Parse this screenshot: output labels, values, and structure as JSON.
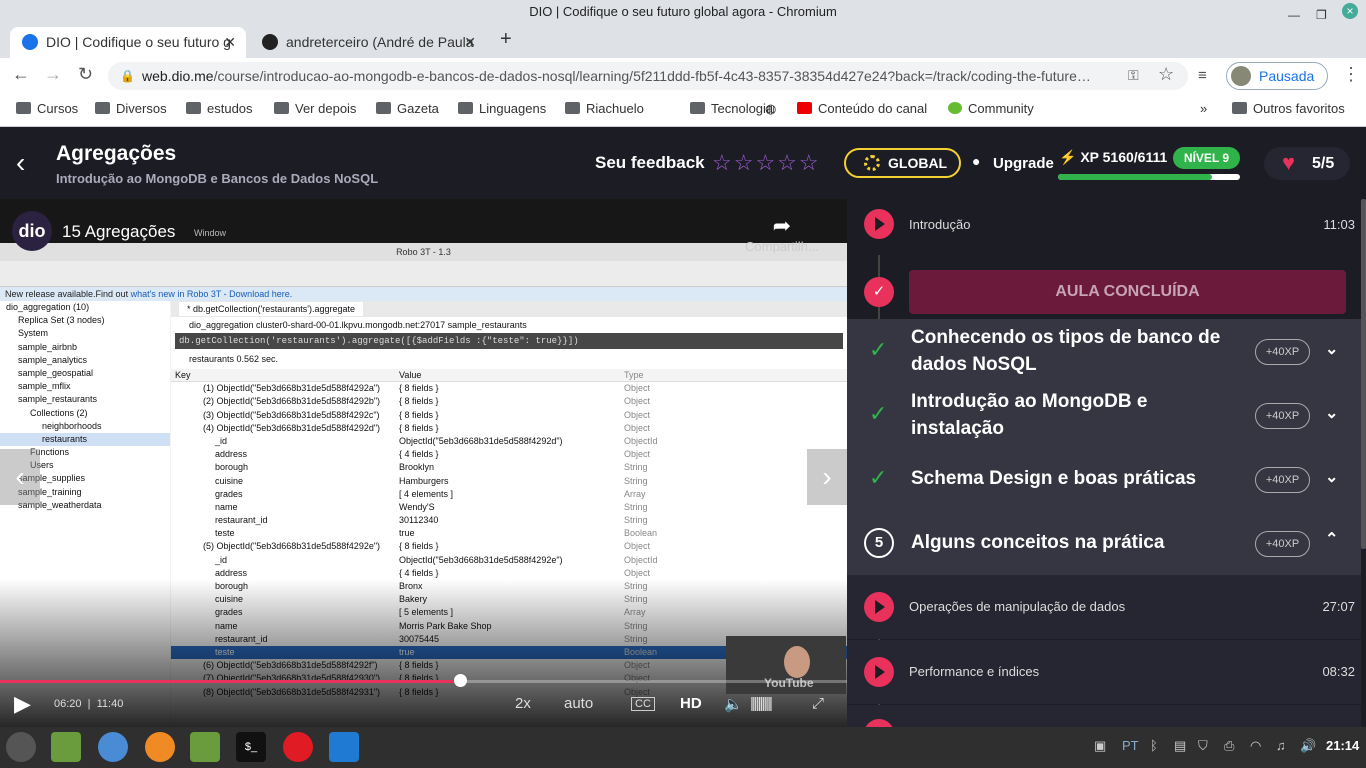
{
  "window": {
    "title": "DIO | Codifique o seu futuro global agora - Chromium"
  },
  "tabs": [
    {
      "label": "DIO | Codifique o seu futuro g"
    },
    {
      "label": "andreterceiro (André de Paula"
    }
  ],
  "address": {
    "domain": "web.dio.me",
    "path": "/course/introducao-ao-mongodb-e-bancos-de-dados-nosql/learning/5f211ddd-fb5f-4c43-8357-38354d427e24?back=/track/coding-the-future…",
    "profile": "Pausada"
  },
  "bookmarks": [
    "Cursos",
    "Diversos",
    "estudos",
    "Ver depois",
    "Gazeta",
    "Linguagens",
    "Riachuelo",
    "Tecnologia",
    "Conteúdo do canal",
    "Community",
    "Outros favoritos"
  ],
  "header": {
    "title": "Agregações",
    "subtitle": "Introdução ao MongoDB e Bancos de Dados NoSQL",
    "feedback": "Seu feedback",
    "global": "GLOBAL",
    "upgrade": "Upgrade",
    "xp": "XP 5160/6111",
    "xp_fraction": 0.845,
    "level": "NÍVEL 9",
    "lives": "5/5"
  },
  "video": {
    "title": "15 Agregações",
    "window_menu": "Window",
    "share": "Compartilh...",
    "current": "06:20",
    "duration": "11:40",
    "speed": "2x",
    "quality_mode": "auto",
    "hd": "HD",
    "progress_fraction": 0.543,
    "robo_title": "Robo 3T - 1.3",
    "notice": "New release available.Find out ",
    "notice_link": "what's new in Robo 3T - Download here.",
    "tab": "* db.getCollection('restaurants').aggregate",
    "conn": "dio_aggregation      cluster0-shard-00-01.lkpvu.mongodb.net:27017      sample_restaurants",
    "query": "db.getCollection('restaurants').aggregate([{$addFields :{\"teste\": true}}])",
    "result": "restaurants      0.562 sec.",
    "cols": [
      "Key",
      "Value",
      "Type"
    ],
    "tree": [
      "dio_aggregation (10)",
      "Replica Set (3 nodes)",
      "System",
      "sample_airbnb",
      "sample_analytics",
      "sample_geospatial",
      "sample_mflix",
      "sample_restaurants",
      "Collections (2)",
      "neighborhoods",
      "restaurants",
      "Functions",
      "Users",
      "sample_supplies",
      "sample_training",
      "sample_weatherdata"
    ],
    "rows": [
      [
        "(1) ObjectId(\"5eb3d668b31de5d588f4292a\")",
        "{ 8 fields }",
        "Object"
      ],
      [
        "(2) ObjectId(\"5eb3d668b31de5d588f4292b\")",
        "{ 8 fields }",
        "Object"
      ],
      [
        "(3) ObjectId(\"5eb3d668b31de5d588f4292c\")",
        "{ 8 fields }",
        "Object"
      ],
      [
        "(4) ObjectId(\"5eb3d668b31de5d588f4292d\")",
        "{ 8 fields }",
        "Object"
      ],
      [
        "_id",
        "ObjectId(\"5eb3d668b31de5d588f4292d\")",
        "ObjectId"
      ],
      [
        "address",
        "{ 4 fields }",
        "Object"
      ],
      [
        "borough",
        "Brooklyn",
        "String"
      ],
      [
        "cuisine",
        "Hamburgers",
        "String"
      ],
      [
        "grades",
        "[ 4 elements ]",
        "Array"
      ],
      [
        "name",
        "Wendy'S",
        "String"
      ],
      [
        "restaurant_id",
        "30112340",
        "String"
      ],
      [
        "teste",
        "true",
        "Boolean"
      ],
      [
        "(5) ObjectId(\"5eb3d668b31de5d588f4292e\")",
        "{ 8 fields }",
        "Object"
      ],
      [
        "_id",
        "ObjectId(\"5eb3d668b31de5d588f4292e\")",
        "ObjectId"
      ],
      [
        "address",
        "{ 4 fields }",
        "Object"
      ],
      [
        "borough",
        "Bronx",
        "String"
      ],
      [
        "cuisine",
        "Bakery",
        "String"
      ],
      [
        "grades",
        "[ 5 elements ]",
        "Array"
      ],
      [
        "name",
        "Morris Park Bake Shop",
        "String"
      ],
      [
        "restaurant_id",
        "30075445",
        "String"
      ],
      [
        "teste",
        "true",
        "Boolean"
      ],
      [
        "(6) ObjectId(\"5eb3d668b31de5d588f4292f\")",
        "{ 8 fields }",
        "Object"
      ],
      [
        "(7) ObjectId(\"5eb3d668b31de5d588f42930\")",
        "{ 8 fields }",
        "Object"
      ],
      [
        "(8) ObjectId(\"5eb3d668b31de5d588f42931\")",
        "{ 8 fields }",
        "Object"
      ]
    ]
  },
  "sidebar": {
    "lesson_intro": {
      "name": "Introdução",
      "time": "11:03"
    },
    "done_label": "AULA CONCLUÍDA",
    "modules": [
      {
        "title": "Conhecendo os tipos de banco de dados NoSQL",
        "xp": "+40XP"
      },
      {
        "title": "Introdução ao MongoDB e instalação",
        "xp": "+40XP"
      },
      {
        "title": "Schema Design e boas práticas",
        "xp": "+40XP"
      },
      {
        "title": "Alguns conceitos na prática",
        "xp": "+40XP",
        "number": "5"
      }
    ],
    "lessons": [
      {
        "name": "Operações de manipulação de dados",
        "time": "27:07"
      },
      {
        "name": "Performance e índices",
        "time": "08:32"
      }
    ]
  },
  "taskbar": {
    "lang": "PT",
    "clock": "21:14"
  }
}
